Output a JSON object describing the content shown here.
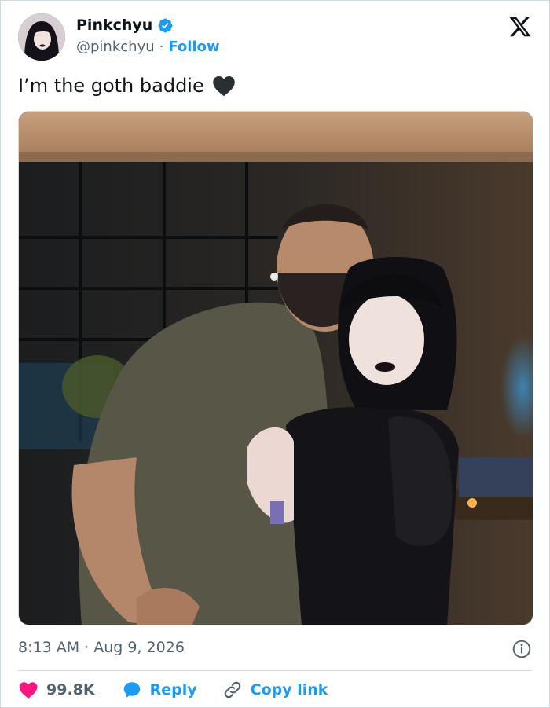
{
  "author": {
    "display_name": "Pinkchyu",
    "handle": "@pinkchyu",
    "separator": "·",
    "follow_label": "Follow",
    "verified": true
  },
  "tweet": {
    "text": "I’m the goth baddie",
    "emoji": "black-heart-icon"
  },
  "meta": {
    "time": "8:13 AM",
    "separator": "·",
    "date": "Aug 9, 2026"
  },
  "actions": {
    "likes_count": "99.8K",
    "reply_label": "Reply",
    "copy_link_label": "Copy link"
  },
  "colors": {
    "accent": "#1d9bf0",
    "like": "#f91880",
    "muted": "#536471",
    "text": "#0f1419"
  },
  "icons": {
    "close": "x-logo-icon",
    "info": "info-icon",
    "like": "heart-icon",
    "reply": "speech-bubble-icon",
    "copy": "link-icon"
  }
}
